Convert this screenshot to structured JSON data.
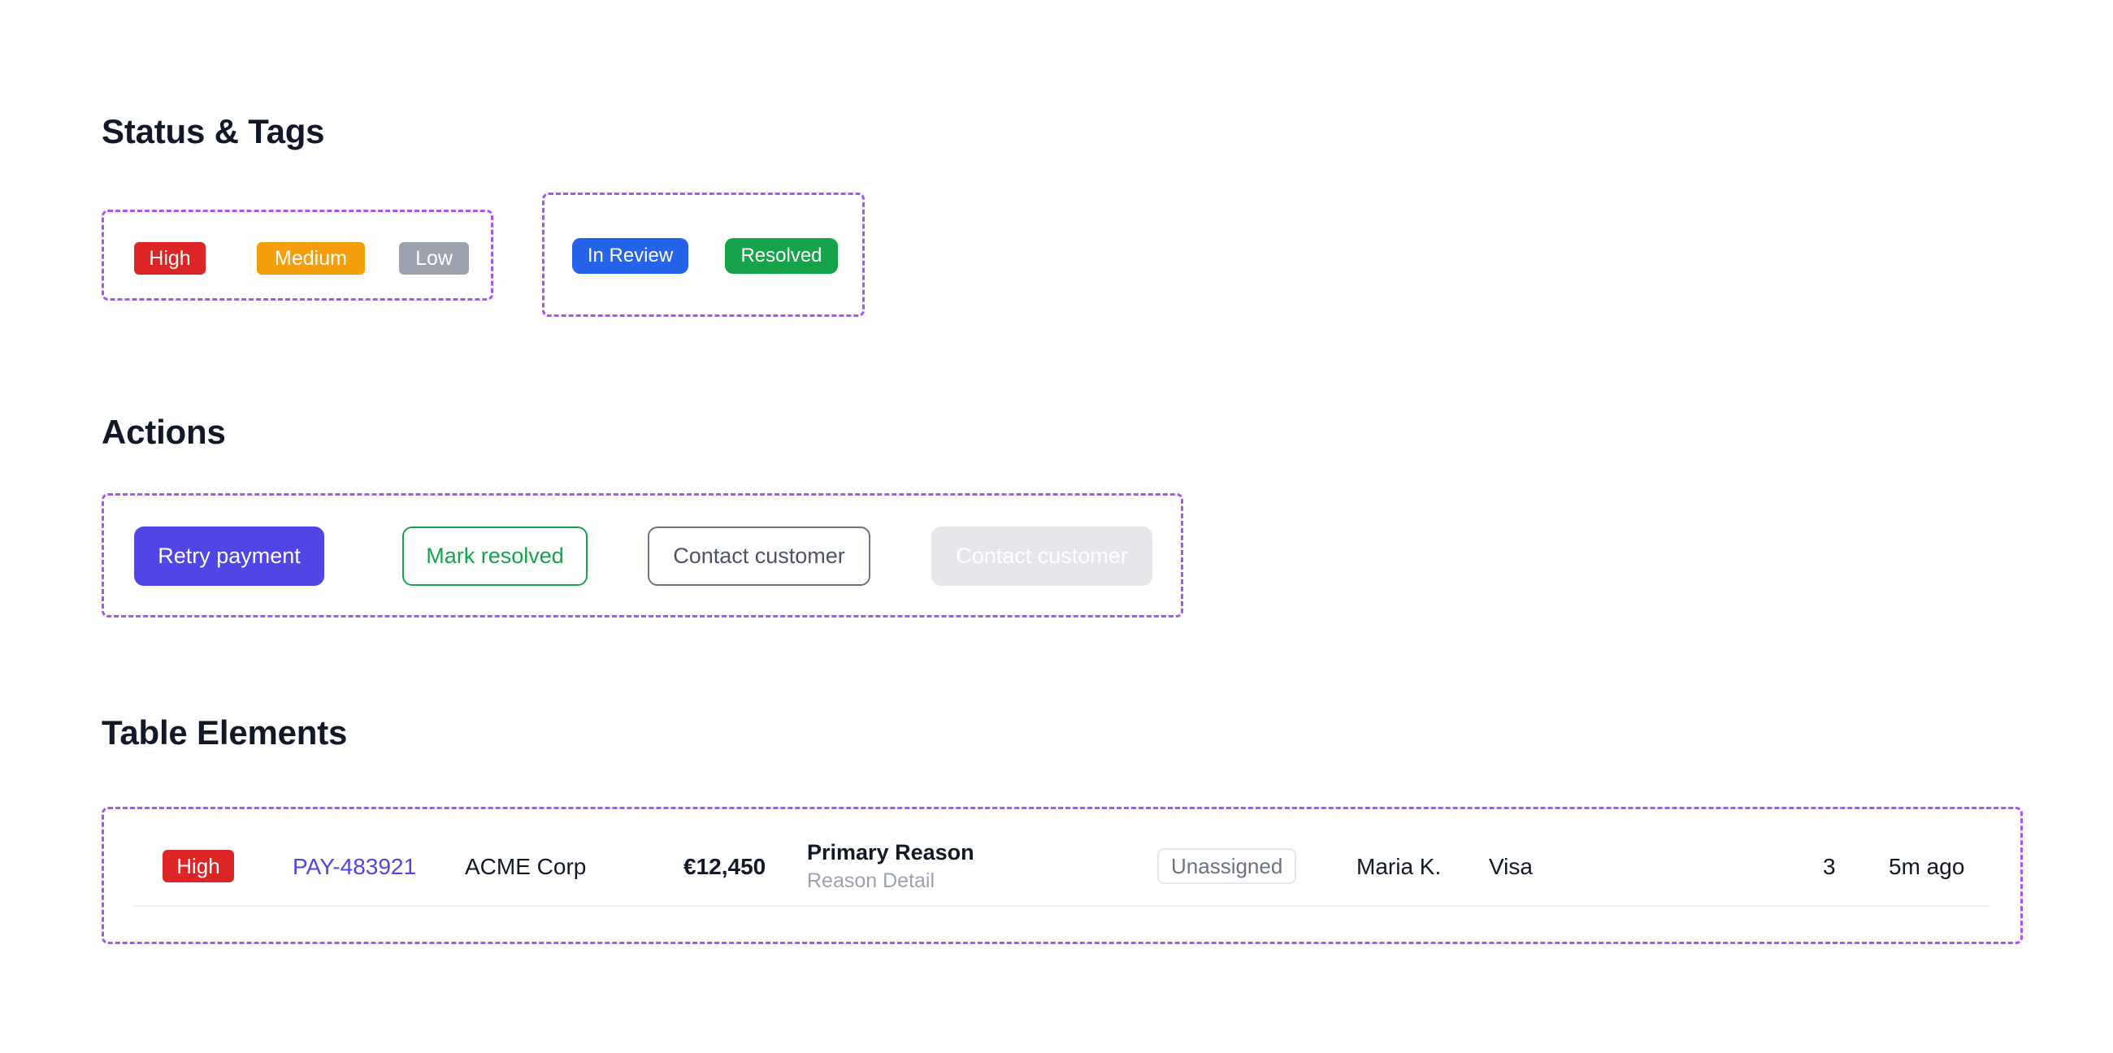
{
  "sections": {
    "status_title": "Status & Tags",
    "actions_title": "Actions",
    "table_title": "Table Elements"
  },
  "priority_tags": {
    "high": "High",
    "medium": "Medium",
    "low": "Low"
  },
  "status_tags": {
    "in_review": "In Review",
    "resolved": "Resolved"
  },
  "actions": {
    "retry": "Retry payment",
    "mark_resolved": "Mark resolved",
    "contact": "Contact customer",
    "contact_disabled": "Contact customer"
  },
  "table_row": {
    "priority": "High",
    "payment_id": "PAY-483921",
    "customer": "ACME Corp",
    "amount": "€12,450",
    "reason_primary": "Primary Reason",
    "reason_detail": "Reason Detail",
    "assignee_badge": "Unassigned",
    "agent": "Maria K.",
    "card": "Visa",
    "attempts": "3",
    "time": "5m ago"
  },
  "colors": {
    "high": "#dc2626",
    "medium": "#f59e0b",
    "low": "#9ca3af",
    "in_review": "#2563eb",
    "resolved": "#16a34a",
    "primary": "#4f46e5",
    "link": "#4f46e5",
    "group_border": "#a855f7"
  }
}
